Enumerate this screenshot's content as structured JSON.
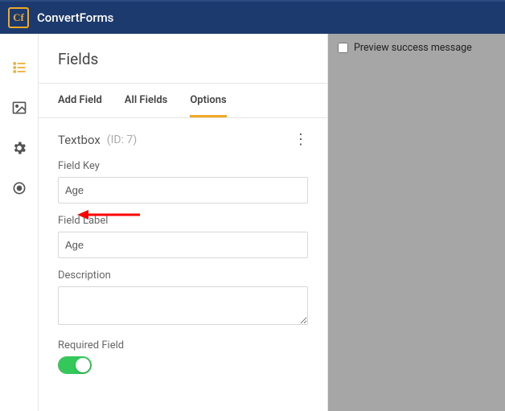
{
  "brand": "ConvertForms",
  "logo_text": "Cf",
  "panel": {
    "title": "Fields"
  },
  "tabs": {
    "add": "Add Field",
    "all": "All Fields",
    "options": "Options"
  },
  "editor": {
    "type_label": "Textbox",
    "id_label": "(ID: 7)",
    "field_key_label": "Field Key",
    "field_key_value": "Age",
    "field_label_label": "Field Label",
    "field_label_value": "Age",
    "description_label": "Description",
    "description_value": "",
    "required_label": "Required Field"
  },
  "preview": {
    "checkbox_label": "Preview success message"
  }
}
